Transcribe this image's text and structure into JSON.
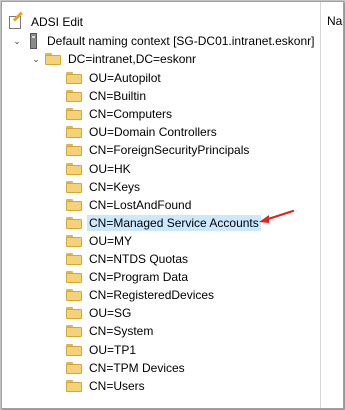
{
  "tree": {
    "root": {
      "label": "ADSI Edit",
      "icon": "adsi-edit-icon"
    },
    "context": {
      "label": "Default naming context [SG-DC01.intranet.eskonr]",
      "icon": "server-icon",
      "expander": "chevron-down-icon"
    },
    "domain": {
      "label": "DC=intranet,DC=eskonr",
      "icon": "folder-icon",
      "expander": "chevron-down-icon"
    },
    "items": [
      {
        "label": "OU=Autopilot"
      },
      {
        "label": "CN=Builtin"
      },
      {
        "label": "CN=Computers"
      },
      {
        "label": "OU=Domain Controllers"
      },
      {
        "label": "CN=ForeignSecurityPrincipals"
      },
      {
        "label": "OU=HK"
      },
      {
        "label": "CN=Keys"
      },
      {
        "label": "CN=LostAndFound"
      },
      {
        "label": "CN=Managed Service Accounts",
        "selected": true
      },
      {
        "label": "OU=MY"
      },
      {
        "label": "CN=NTDS Quotas"
      },
      {
        "label": "CN=Program Data"
      },
      {
        "label": "CN=RegisteredDevices"
      },
      {
        "label": "OU=SG"
      },
      {
        "label": "CN=System"
      },
      {
        "label": "OU=TP1"
      },
      {
        "label": "CN=TPM Devices"
      },
      {
        "label": "CN=Users"
      }
    ]
  },
  "right_pane": {
    "column_header": "Na"
  },
  "colors": {
    "selection": "#cce8ff",
    "annotation_arrow": "#e0231b",
    "folder": "#f5d27a"
  }
}
